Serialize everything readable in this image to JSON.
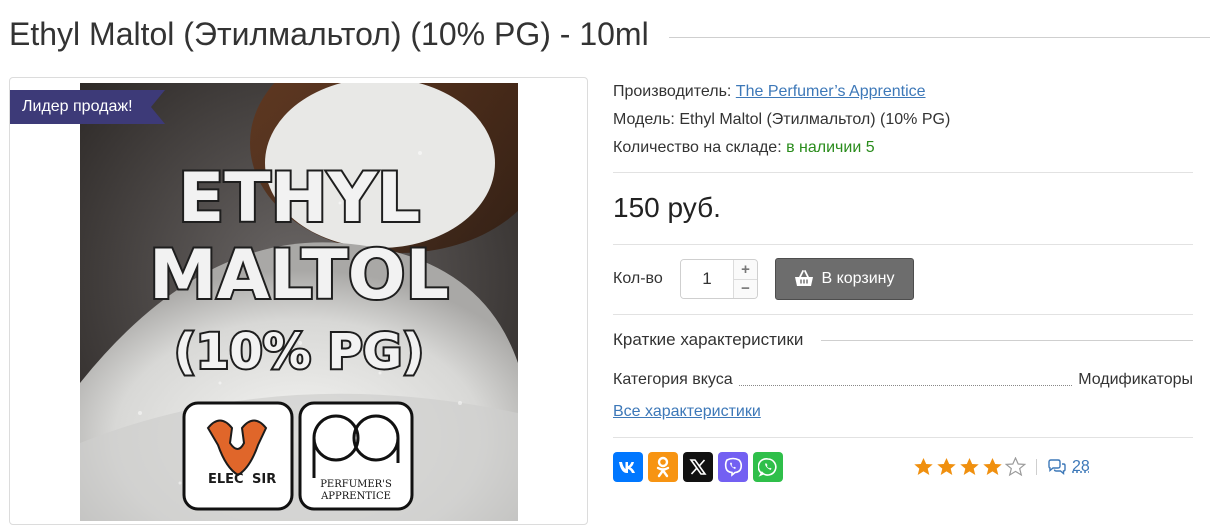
{
  "product": {
    "title": "Ethyl Maltol (Этилмальтол) (10% PG) - 10ml",
    "badge": "Лидер продаж!",
    "image_alt": "Ethyl Maltol (10% PG)",
    "image_text": {
      "line1": "ETHYL",
      "line2": "MALTOL",
      "line3": "(10% PG)",
      "logo_left_a": "ELEC",
      "logo_left_b": "SIR",
      "logo_right_a": "PERFUMER'S",
      "logo_right_b": "APPRENTICE"
    }
  },
  "info": {
    "manufacturer_label": "Производитель:",
    "manufacturer_value": "The Perfumer’s Apprentice",
    "model_label": "Модель:",
    "model_value": "Ethyl Maltol (Этилмальтол) (10% PG)",
    "stock_label": "Количество на складе:",
    "stock_value": "в наличии 5"
  },
  "price": "150 руб.",
  "purchase": {
    "qty_label": "Кол-во",
    "qty_value": "1",
    "plus": "+",
    "minus": "−",
    "cart_label": "В корзину"
  },
  "specs": {
    "heading": "Краткие характеристики",
    "rows": [
      {
        "name": "Категория вкуса",
        "value": "Модификаторы"
      }
    ],
    "all_link": "Все характеристики"
  },
  "share": {
    "buttons": [
      {
        "name": "vk",
        "glyph": "vk"
      },
      {
        "name": "odnoklassniki",
        "glyph": "ok"
      },
      {
        "name": "x-twitter",
        "glyph": "x"
      },
      {
        "name": "viber",
        "glyph": "viber"
      },
      {
        "name": "whatsapp",
        "glyph": "whatsapp"
      }
    ]
  },
  "rating": {
    "stars": 4,
    "max": 5,
    "reviews_count": "28"
  },
  "colors": {
    "badge": "#3d3a78",
    "link": "#3d78b8",
    "in_stock": "#2a8c1c",
    "cart_button": "#6d6d6d",
    "star": "#f0900f"
  }
}
